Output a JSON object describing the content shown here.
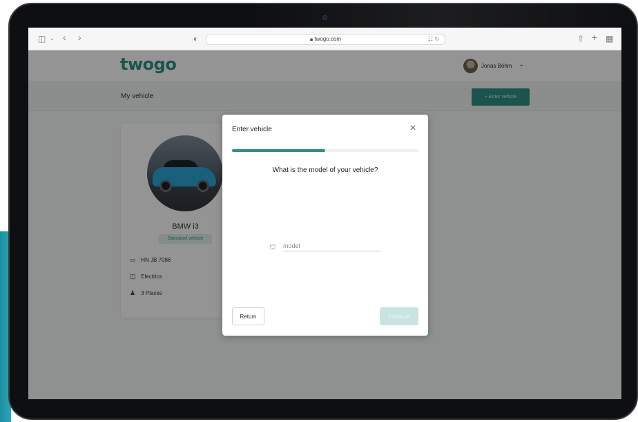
{
  "browser": {
    "url": "twogo.com",
    "icons": [
      "sidebar-icon",
      "chevron-down-icon",
      "back-icon",
      "forward-icon",
      "privacy-icon",
      "lock-icon",
      "translate-icon",
      "reload-icon",
      "share-icon",
      "new-tab-icon",
      "tab-overview-icon"
    ]
  },
  "header": {
    "logo": "twogo",
    "user_name": "Jonas Böhm"
  },
  "subbar": {
    "title": "My vehicle",
    "enter_vehicle_label": "+ Enter vehicle"
  },
  "vehicle": {
    "name": "BMW i3",
    "badge": "Standard vehicle",
    "details": [
      {
        "icon": "license-plate-icon",
        "text": "HN JB 7086"
      },
      {
        "icon": "fuel-pump-icon",
        "text": "Electrics"
      },
      {
        "icon": "seat-icon",
        "text": "3 Places"
      }
    ]
  },
  "modal": {
    "title": "Enter vehicle",
    "question": "What is the model of your vehicle?",
    "model_placeholder": "model",
    "model_value": "",
    "return_label": "Return",
    "continue_label": "Continue",
    "progress": 0.5
  },
  "colors": {
    "brand": "#2f8f86",
    "accent_light": "#e4f2f0"
  }
}
